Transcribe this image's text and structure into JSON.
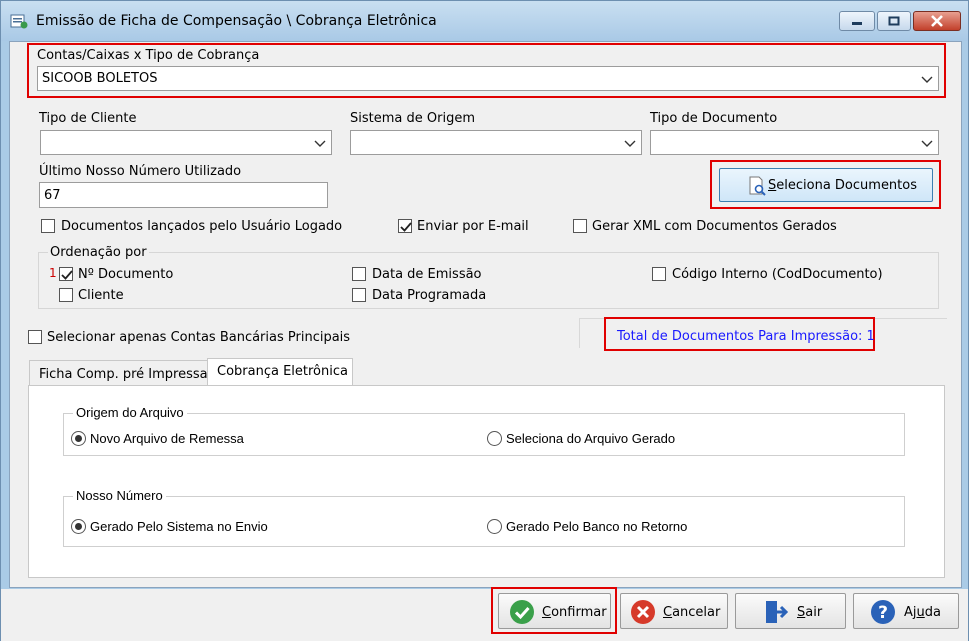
{
  "window": {
    "title": "Emissão de Ficha de Compensação \\ Cobrança Eletrônica",
    "controls": [
      "minimize-icon",
      "maximize-icon",
      "close-icon"
    ]
  },
  "account": {
    "label": "Contas/Caixas x Tipo de Cobrança",
    "value": "SICOOB  BOLETOS"
  },
  "filters": {
    "client_type_label": "Tipo de Cliente",
    "client_type_value": "",
    "origin_system_label": "Sistema de Origem",
    "origin_system_value": "",
    "doc_type_label": "Tipo de Documento",
    "doc_type_value": ""
  },
  "last_number": {
    "label": "Último Nosso Número Utilizado",
    "value": "67"
  },
  "select_docs_button": {
    "label_prefix": "",
    "label_underlined": "S",
    "label_rest": "eleciona Documentos"
  },
  "options": {
    "docs_by_user": {
      "label": "Documentos lançados pelo Usuário Logado",
      "checked": false
    },
    "send_email": {
      "label": "Enviar por E-mail",
      "checked": true
    },
    "gen_xml": {
      "label": "Gerar XML com Documentos Gerados",
      "checked": false
    }
  },
  "ordering": {
    "title": "Ordenação por",
    "order_badge": "1",
    "items": {
      "doc_number": {
        "label": "Nº Documento",
        "checked": true
      },
      "client": {
        "label": "Cliente",
        "checked": false
      },
      "issue_date": {
        "label": "Data de Emissão",
        "checked": false
      },
      "scheduled_date": {
        "label": "Data Programada",
        "checked": false
      },
      "internal_code": {
        "label": "Código Interno (CodDocumento)",
        "checked": false
      }
    }
  },
  "main_accounts_only": {
    "label": "Selecionar apenas Contas Bancárias Principais",
    "checked": false
  },
  "total_docs": "Total de Documentos Para Impressão: 1",
  "tabs": [
    {
      "label": "Ficha Comp. pré Impressa",
      "active": false
    },
    {
      "label": "Cobrança Eletrônica",
      "active": true
    }
  ],
  "file_origin": {
    "title": "Origem do Arquivo",
    "new_file": {
      "label": "Novo Arquivo de Remessa",
      "selected": true
    },
    "generated_file": {
      "label": "Seleciona do Arquivo Gerado",
      "selected": false
    }
  },
  "our_number": {
    "title": "Nosso Número",
    "by_system": {
      "label": "Gerado Pelo Sistema no Envio",
      "selected": true
    },
    "by_bank": {
      "label": "Gerado Pelo Banco  no Retorno",
      "selected": false
    }
  },
  "footer_buttons": {
    "confirm": {
      "u": "C",
      "rest": "onfirmar"
    },
    "cancel": {
      "u": "C",
      "rest": "ancelar"
    },
    "exit": {
      "u": "S",
      "rest": "air"
    },
    "help": {
      "pre": "Aj",
      "u": "u",
      "rest": "da"
    }
  },
  "colors": {
    "highlight_border": "#e00000",
    "total_text": "#1a1aff",
    "confirm_icon": "#3aa04a",
    "cancel_icon": "#d63a2a",
    "help_icon": "#2a62b8"
  }
}
